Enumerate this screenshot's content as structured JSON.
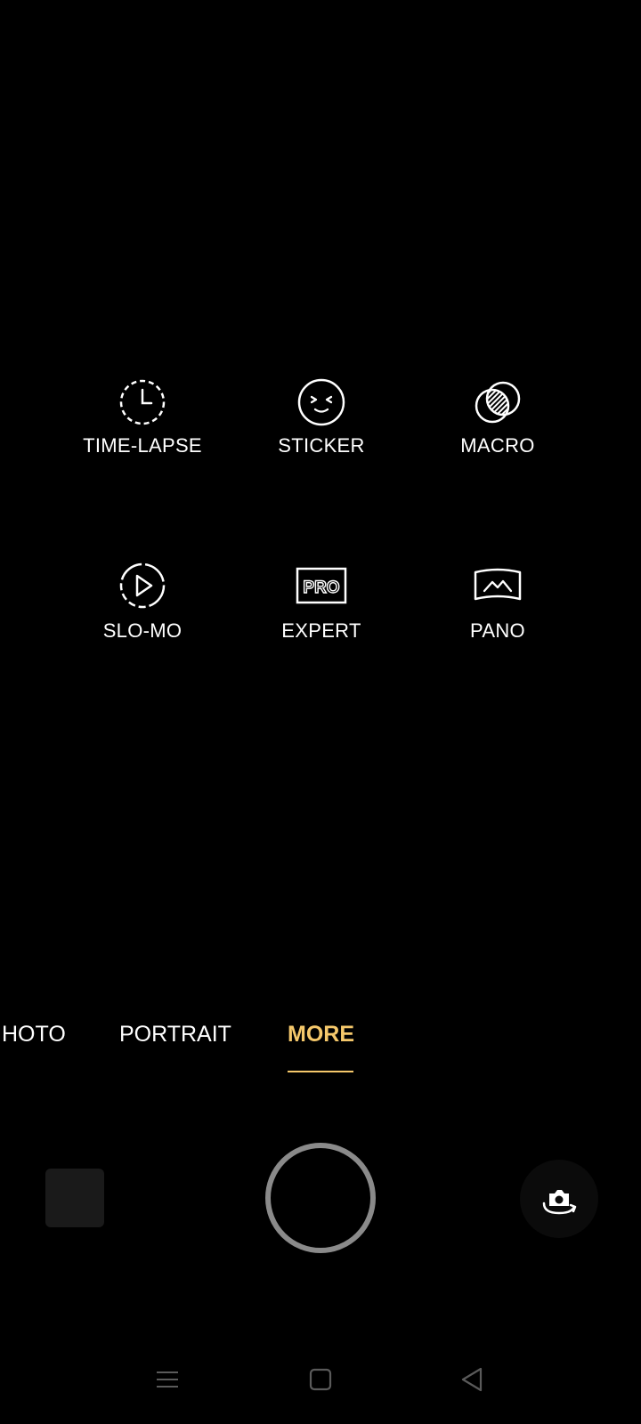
{
  "modes": [
    {
      "label": "TIME-LAPSE",
      "icon": "timelapse-icon"
    },
    {
      "label": "STICKER",
      "icon": "sticker-icon"
    },
    {
      "label": "MACRO",
      "icon": "macro-icon"
    },
    {
      "label": "SLO-MO",
      "icon": "slowmo-icon"
    },
    {
      "label": "EXPERT",
      "icon": "expert-pro-icon",
      "icon_text": "PRO"
    },
    {
      "label": "PANO",
      "icon": "panorama-icon"
    }
  ],
  "tabs": [
    {
      "label": "HOTO"
    },
    {
      "label": "PORTRAIT"
    },
    {
      "label": "MORE",
      "active": true
    }
  ],
  "colors": {
    "background": "#000000",
    "text": "#ffffff",
    "accent": "#f5c86b",
    "shutter_ring": "#8a8a8a",
    "thumbnail": "#1a1a1a",
    "nav_icon": "#5a5a5a"
  },
  "controls": {
    "thumbnail_icon": "gallery-thumbnail",
    "shutter_icon": "shutter-button",
    "flip_icon": "flip-camera-icon"
  },
  "nav": {
    "menu_icon": "menu-icon",
    "home_icon": "home-icon",
    "back_icon": "back-icon"
  }
}
